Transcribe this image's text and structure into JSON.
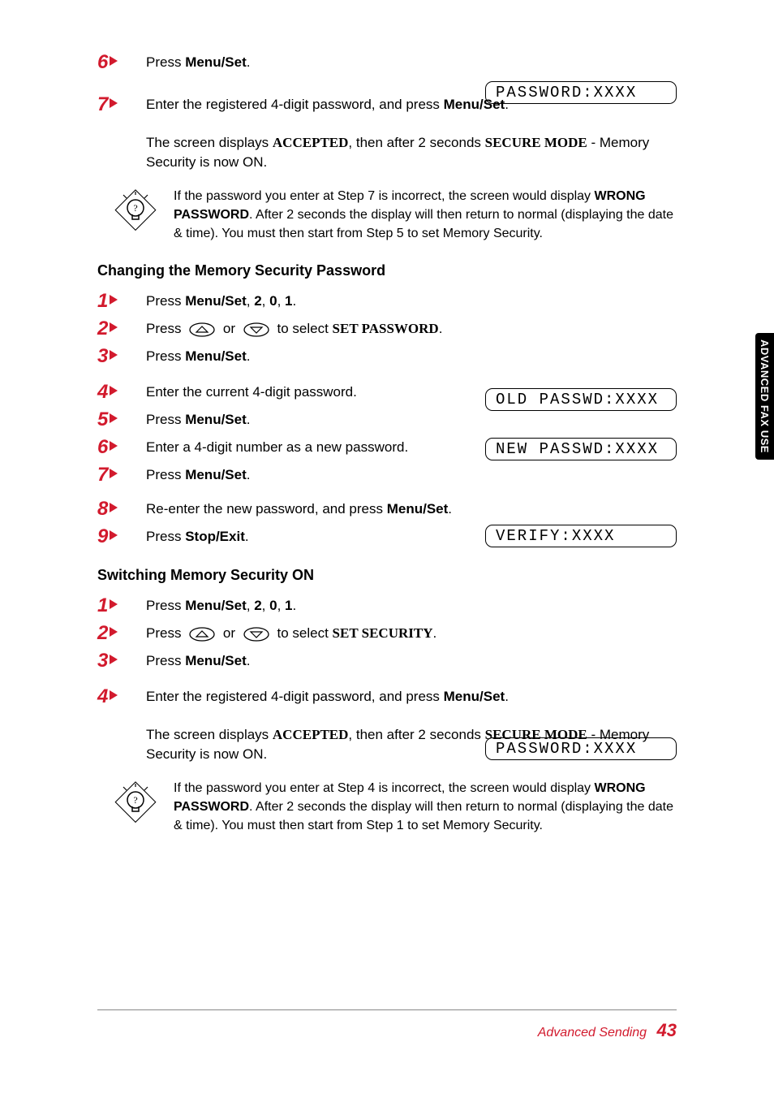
{
  "sidebar_tab": "ADVANCED FAX USE",
  "footer": {
    "section": "Advanced Sending",
    "page": "43"
  },
  "intro_lcd1": "PASSWORD:XXXX",
  "intro_steps": {
    "s6_num": "6",
    "s6_text_pre": "Press ",
    "s6_text_btn": "Menu/Set",
    "s6_text_post": ".",
    "s7_num": "7",
    "s7_text_pre": "Enter the registered 4-digit password, and press ",
    "s7_text_btn": "Menu/Set",
    "s7_text_post": "."
  },
  "intro_result": {
    "pre": "The screen displays ",
    "accepted": "ACCEPTED",
    "mid": ", then after 2 seconds ",
    "secure": "SECURE MODE",
    "post": " - Memory Security is now ON."
  },
  "note1": {
    "l1_pre": "If the password you enter at Step 7 is incorrect, the screen would display ",
    "l1_wrong": "WRONG PASSWORD",
    "l2": ". After 2 seconds the display will then return to normal (displaying the date & time). You must then start from Step 5 to set Memory Security."
  },
  "sect1_title": "Changing the Memory Security Password",
  "sect1": {
    "s1_num": "1",
    "s1_pre": "Press ",
    "s1_btn": "Menu/Set",
    "s1_mid": ", ",
    "s1_k1": "2",
    "s1_c1": ", ",
    "s1_k2": "0",
    "s1_c2": ", ",
    "s1_k3": "1",
    "s1_post": ".",
    "s2_num": "2",
    "s2_pre": "Press ",
    "s2_mid": " or ",
    "s2_mid2": " to select ",
    "s2_sel": "SET PASSWORD",
    "s2_post": ".",
    "s3_num": "3",
    "s3_pre": "Press ",
    "s3_btn": "Menu/Set",
    "s3_post": ".",
    "s3_lcd": "OLD PASSWD:XXXX",
    "s4_num": "4",
    "s4_text": "Enter the current 4-digit password.",
    "s5_num": "5",
    "s5_pre": "Press ",
    "s5_btn": "Menu/Set",
    "s5_post": ".",
    "s5_lcd": "NEW PASSWD:XXXX",
    "s6_num": "6",
    "s6_text": "Enter a 4-digit number as a new password.",
    "s7_num": "7",
    "s7_pre": "Press ",
    "s7_btn": "Menu/Set",
    "s7_post": ".",
    "s7_lcd": "VERIFY:XXXX",
    "s8_num": "8",
    "s8_pre": "Re-enter the new password, and press ",
    "s8_btn": "Menu/Set",
    "s8_post": ".",
    "s9_num": "9",
    "s9_pre": "Press ",
    "s9_btn": "Stop/Exit",
    "s9_post": "."
  },
  "sect2_title": "Switching Memory Security ON",
  "sect2": {
    "s1_num": "1",
    "s1_pre": "Press ",
    "s1_btn": "Menu/Set",
    "s1_mid": ", ",
    "s1_k1": "2",
    "s1_c1": ", ",
    "s1_k2": "0",
    "s1_c2": ", ",
    "s1_k3": "1",
    "s1_post": ".",
    "s2_num": "2",
    "s2_pre": "Press ",
    "s2_mid": " or ",
    "s2_mid2": " to select ",
    "s2_sel": "SET SECURITY",
    "s2_post": ".",
    "s3_num": "3",
    "s3_pre": "Press ",
    "s3_btn": "Menu/Set",
    "s3_post": ".",
    "s3_lcd": "PASSWORD:XXXX",
    "s4_num": "4",
    "s4_pre": "Enter the registered 4-digit password, and press ",
    "s4_btn": "Menu/Set",
    "s4_post": "."
  },
  "sect2_result": {
    "pre": "The screen displays ",
    "accepted": "ACCEPTED",
    "mid": ", then after 2 seconds ",
    "secure": "SECURE MODE",
    "post": " - Memory Security is now ON."
  },
  "note2": {
    "l1_pre": "If the password you enter at Step 4 is incorrect, the screen would display ",
    "l1_wrong": "WRONG PASSWORD",
    "l2": ". After 2 seconds the display will then return to normal (displaying the date & time). You must then start from Step 1 to set Memory Security."
  }
}
